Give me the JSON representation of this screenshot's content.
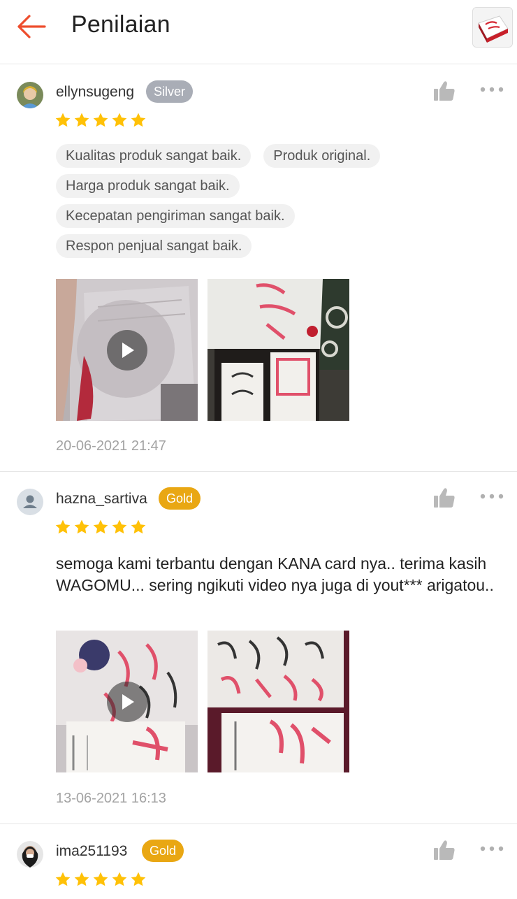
{
  "header": {
    "title": "Penilaian"
  },
  "colors": {
    "accent": "#ee4d2d",
    "star": "#ffc107",
    "silver_badge": "#a9adb6",
    "gold_badge": "#e9a713"
  },
  "reviews": [
    {
      "username": "ellynsugeng",
      "badge": "Silver",
      "rating": 5,
      "tags": [
        "Kualitas produk sangat baik.",
        "Produk original.",
        "Harga produk sangat baik.",
        "Kecepatan pengiriman sangat baik.",
        "Respon penjual sangat baik."
      ],
      "media": [
        {
          "type": "video",
          "icon": "play-icon"
        },
        {
          "type": "photo"
        }
      ],
      "date": "20-06-2021 21:47"
    },
    {
      "username": "hazna_sartiva",
      "badge": "Gold",
      "rating": 5,
      "comment": "semoga kami terbantu dengan KANA card nya.. terima kasih WAGOMU... sering ngikuti video nya juga di yout*** arigatou..",
      "media": [
        {
          "type": "video",
          "icon": "play-icon"
        },
        {
          "type": "photo"
        }
      ],
      "date": "13-06-2021 16:13"
    },
    {
      "username": "ima251193",
      "badge": "Gold",
      "rating": 5
    }
  ],
  "icons": [
    "back-arrow-icon",
    "thumbs-up-icon",
    "more-options-icon",
    "star-icon",
    "play-icon",
    "default-avatar-icon"
  ]
}
